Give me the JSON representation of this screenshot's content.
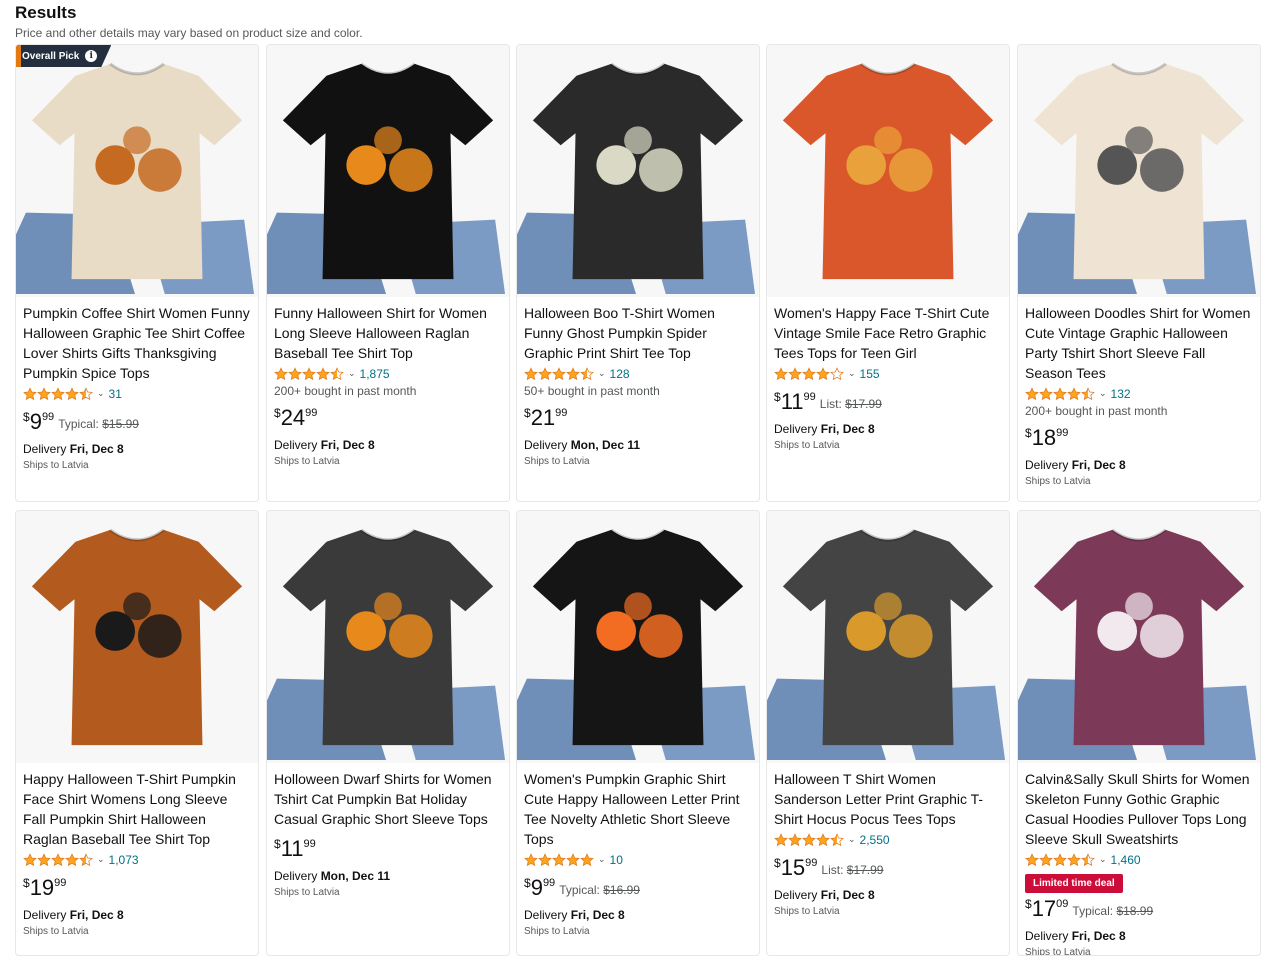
{
  "header": {
    "title": "Results",
    "subtitle": "Price and other details may vary based on product size and color."
  },
  "colors": {
    "link": "#007185",
    "star": "#ffa41c",
    "badge": "#232f3e",
    "deal": "#cc0c39"
  },
  "products": [
    {
      "badge": "Overall Pick",
      "title": "Pumpkin Coffee Shirt Women Funny Halloween Graphic Tee Shirt Coffee Lover Shirts Gifts Thanksgiving Pumpkin Spice Tops",
      "rating": 4.5,
      "reviews": "31",
      "bought": "",
      "price_symbol": "$",
      "price_whole": "9",
      "price_fraction": "99",
      "price_label": "Typical:",
      "price_old": "$15.99",
      "deal": "",
      "delivery_prefix": "Delivery",
      "delivery_date": "Fri, Dec 8",
      "ships": "Ships to Latvia",
      "image": {
        "shirt": "#e9dcc6",
        "accent": "#c46a21",
        "jeans": true
      }
    },
    {
      "badge": "",
      "title": "Funny Halloween Shirt for Women Long Sleeve Halloween Raglan Baseball Tee Shirt Top",
      "rating": 4.5,
      "reviews": "1,875",
      "bought": "200+ bought in past month",
      "price_symbol": "$",
      "price_whole": "24",
      "price_fraction": "99",
      "price_label": "",
      "price_old": "",
      "deal": "",
      "delivery_prefix": "Delivery",
      "delivery_date": "Fri, Dec 8",
      "ships": "Ships to Latvia",
      "image": {
        "shirt": "#111111",
        "accent": "#e8891c",
        "jeans": true
      }
    },
    {
      "badge": "",
      "title": "Halloween Boo T-Shirt Women Funny Ghost Pumpkin Spider Graphic Print Shirt Tee Top",
      "rating": 4.5,
      "reviews": "128",
      "bought": "50+ bought in past month",
      "price_symbol": "$",
      "price_whole": "21",
      "price_fraction": "99",
      "price_label": "",
      "price_old": "",
      "deal": "",
      "delivery_prefix": "Delivery",
      "delivery_date": "Mon, Dec 11",
      "ships": "Ships to Latvia",
      "image": {
        "shirt": "#2a2a2a",
        "accent": "#d9d9c6",
        "jeans": true
      }
    },
    {
      "badge": "",
      "title": "Women's Happy Face T-Shirt Cute Vintage Smile Face Retro Graphic Tees Tops for Teen Girl",
      "rating": 4.0,
      "reviews": "155",
      "bought": "",
      "price_symbol": "$",
      "price_whole": "11",
      "price_fraction": "99",
      "price_label": "List:",
      "price_old": "$17.99",
      "deal": "",
      "delivery_prefix": "Delivery",
      "delivery_date": "Fri, Dec 8",
      "ships": "Ships to Latvia",
      "image": {
        "shirt": "#d9572a",
        "accent": "#e9a23b",
        "jeans": false
      }
    },
    {
      "badge": "",
      "title": "Halloween Doodles Shirt for Women Cute Vintage Graphic Halloween Party Tshirt Short Sleeve Fall Season Tees",
      "rating": 4.5,
      "reviews": "132",
      "bought": "200+ bought in past month",
      "price_symbol": "$",
      "price_whole": "18",
      "price_fraction": "99",
      "price_label": "",
      "price_old": "",
      "deal": "",
      "delivery_prefix": "Delivery",
      "delivery_date": "Fri, Dec 8",
      "ships": "Ships to Latvia",
      "image": {
        "shirt": "#efe4d3",
        "accent": "#555555",
        "jeans": true
      }
    },
    {
      "badge": "",
      "title": "Happy Halloween T-Shirt Pumpkin Face Shirt Womens Long Sleeve Fall Pumpkin Shirt Halloween Raglan Baseball Tee Shirt Top",
      "rating": 4.5,
      "reviews": "1,073",
      "bought": "",
      "price_symbol": "$",
      "price_whole": "19",
      "price_fraction": "99",
      "price_label": "",
      "price_old": "",
      "deal": "",
      "delivery_prefix": "Delivery",
      "delivery_date": "Fri, Dec 8",
      "ships": "Ships to Latvia",
      "image": {
        "shirt": "#b35a1f",
        "accent": "#1a1a1a",
        "jeans": false
      }
    },
    {
      "badge": "",
      "title": "Holloween Dwarf Shirts for Women Tshirt Cat Pumpkin Bat Holiday Casual Graphic Short Sleeve Tops",
      "rating": 0,
      "reviews": "",
      "bought": "",
      "price_symbol": "$",
      "price_whole": "11",
      "price_fraction": "99",
      "price_label": "",
      "price_old": "",
      "deal": "",
      "delivery_prefix": "Delivery",
      "delivery_date": "Mon, Dec 11",
      "ships": "Ships to Latvia",
      "image": {
        "shirt": "#3a3a3a",
        "accent": "#e8891c",
        "jeans": true
      }
    },
    {
      "badge": "",
      "title": "Women's Pumpkin Graphic Shirt Cute Happy Halloween Letter Print Tee Novelty Athletic Short Sleeve Tops",
      "rating": 5.0,
      "reviews": "10",
      "bought": "",
      "price_symbol": "$",
      "price_whole": "9",
      "price_fraction": "99",
      "price_label": "Typical:",
      "price_old": "$16.99",
      "deal": "",
      "delivery_prefix": "Delivery",
      "delivery_date": "Fri, Dec 8",
      "ships": "Ships to Latvia",
      "image": {
        "shirt": "#151515",
        "accent": "#f26c21",
        "jeans": true
      }
    },
    {
      "badge": "",
      "title": "Halloween T Shirt Women Sanderson Letter Print Graphic T-Shirt Hocus Pocus Tees Tops",
      "rating": 4.5,
      "reviews": "2,550",
      "bought": "",
      "price_symbol": "$",
      "price_whole": "15",
      "price_fraction": "99",
      "price_label": "List:",
      "price_old": "$17.99",
      "deal": "",
      "delivery_prefix": "Delivery",
      "delivery_date": "Fri, Dec 8",
      "ships": "Ships to Latvia",
      "image": {
        "shirt": "#444444",
        "accent": "#d99a2b",
        "jeans": true
      }
    },
    {
      "badge": "",
      "title": "Calvin&Sally Skull Shirts for Women Skeleton Funny Gothic Graphic Casual Hoodies Pullover Tops Long Sleeve Skull Sweatshirts",
      "rating": 4.5,
      "reviews": "1,460",
      "bought": "",
      "price_symbol": "$",
      "price_whole": "17",
      "price_fraction": "09",
      "price_label": "Typical:",
      "price_old": "$18.99",
      "deal": "Limited time deal",
      "delivery_prefix": "Delivery",
      "delivery_date": "Fri, Dec 8",
      "ships": "Ships to Latvia",
      "image": {
        "shirt": "#7d3a58",
        "accent": "#f1e9ee",
        "jeans": true
      }
    }
  ]
}
